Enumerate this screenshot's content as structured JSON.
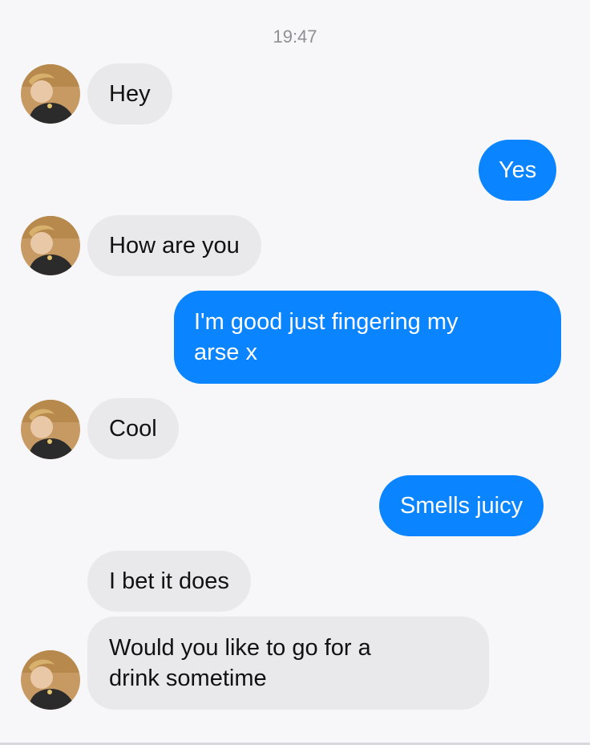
{
  "header": {
    "time": "19:47"
  },
  "colors": {
    "incoming_bubble": "#e9e9eb",
    "outgoing_bubble": "#0a84ff",
    "background": "#f7f7f9"
  },
  "messages": [
    {
      "direction": "incoming",
      "text": "Hey"
    },
    {
      "direction": "outgoing",
      "text": "Yes"
    },
    {
      "direction": "incoming",
      "text": "How are you"
    },
    {
      "direction": "outgoing",
      "line1": "I'm good just fingering my",
      "line2": "arse x"
    },
    {
      "direction": "incoming",
      "text": "Cool"
    },
    {
      "direction": "outgoing",
      "text": "Smells juicy"
    },
    {
      "direction": "incoming",
      "text": "I bet it does"
    },
    {
      "direction": "incoming",
      "line1": "Would you like to go for a",
      "line2": "drink sometime"
    }
  ],
  "avatar_icon": "contact-avatar-icon"
}
